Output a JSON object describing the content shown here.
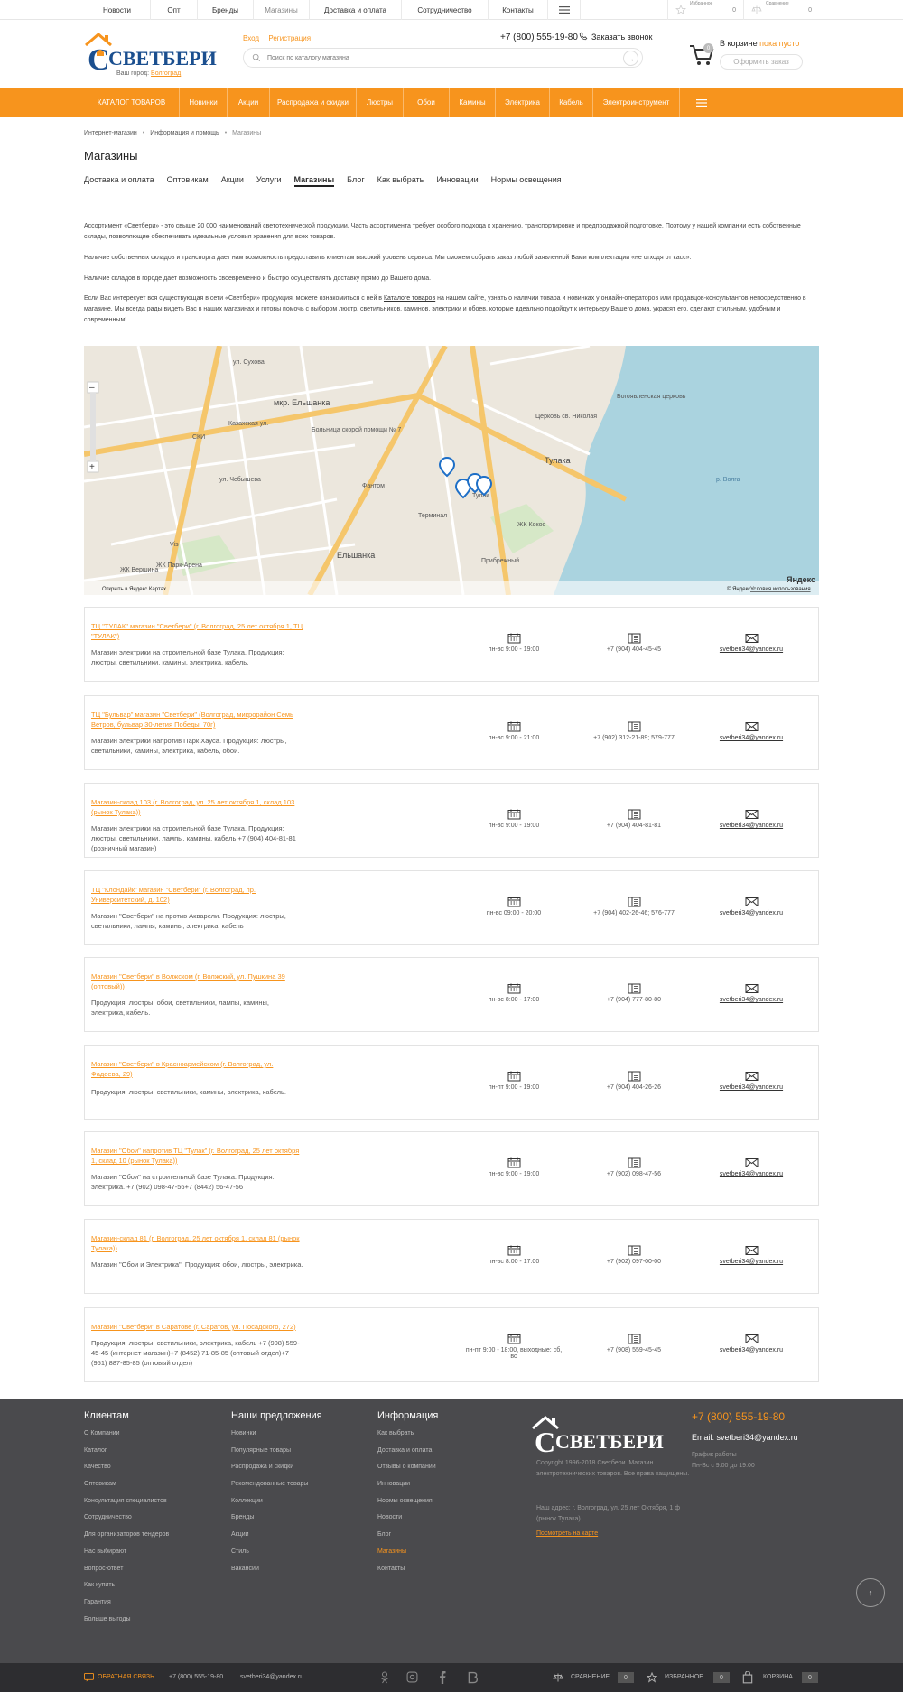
{
  "topnav": [
    "Новости",
    "Опт",
    "Бренды",
    "Магазины",
    "Доставка и оплата",
    "Сотрудничество",
    "Контакты"
  ],
  "top_icons": {
    "favorites_label": "Избранное",
    "favorites_count": "0",
    "compare_label": "Сравнение",
    "compare_count": "0"
  },
  "header": {
    "logo_text": "СВЕТБЕРИ",
    "city_label": "Ваш город:",
    "city": "Волгоград",
    "login": "Вход",
    "register": "Регистрация",
    "phone": "+7 (800) 555-19-80",
    "callback": "Заказать звонок",
    "search_placeholder": "Поиск по каталогу магазина",
    "cart_badge": "0",
    "cart_label": "В корзине",
    "cart_status": "пока пусто",
    "checkout": "Оформить заказ"
  },
  "mainnav": [
    "КАТАЛОГ ТОВАРОВ",
    "Новинки",
    "Акции",
    "Распродажа и скидки",
    "Люстры",
    "Обои",
    "Камины",
    "Электрика",
    "Кабель",
    "Электроинструмент"
  ],
  "breadcrumbs": [
    "Интернет-магазин",
    "Информация и помощь",
    "Магазины"
  ],
  "page_title": "Магазины",
  "subtabs": [
    "Доставка и оплата",
    "Оптовикам",
    "Акции",
    "Услуги",
    "Магазины",
    "Блог",
    "Как выбрать",
    "Инновации",
    "Нормы освещения"
  ],
  "active_subtab": "Магазины",
  "paragraphs": [
    "Ассортимент «Светбери» - это свыше 20 000 наименований светотехнической продукции. Часть ассортимента требует особого подхода к хранению, транспортировке и предпродажной подготовке. Поэтому у нашей компании есть собственные склады, позволяющие обеспечивать идеальные условия хранения для всех товаров.",
    "Наличие собственных складов и транспорта дает нам возможность предоставить клиентам высокий уровень сервиса. Мы сможем собрать заказ любой заявленной Вами комплектации «не отходя от касс».",
    "Наличие складов в городе дает возможность своевременно и быстро осуществлять доставку прямо до Вашего дома."
  ],
  "paragraph4": {
    "before": "Если Вас интересует вся существующая в сети «Светбери» продукция, можете ознакомиться с ней в ",
    "link": "Каталоге товаров",
    "after": " на нашем сайте, узнать о наличии товара и новинках у онлайн-операторов или продавцов-консультантов непосредственно в магазине. Мы всегда рады видеть Вас в наших магазинах и готовы помочь с выбором люстр, светильников, каминов, электрики и обоев, которые идеально подойдут к интерьеру Вашего дома, украсят его, сделают стильным, удобным и современным!"
  },
  "map": {
    "labels": [
      "ул. Сухова",
      "Казахская ул.",
      "мкр. Ельшанка",
      "Больница скорой помощи № 7",
      "ул. Чебышева",
      "СКИ",
      "ЖК Парк-Арена",
      "ЖК Вершина",
      "Ельшанка",
      "Прибрежный",
      "ЖК Кокос",
      "Терминал",
      "Тулак",
      "Тулака",
      "Богоявленская церковь",
      "Церковь св. Николая",
      "р. Волга",
      "Фантом",
      "Vis"
    ],
    "open_link": "Открыть в Яндекс.Картах",
    "copyright": "© Яндекс",
    "terms": "Условия использования",
    "brand": "Яндекс"
  },
  "stores": [
    {
      "name": "ТЦ \"ТУЛАК\" магазин \"Светбери\" (г. Волгоград, 25 лет октября 1, ТЦ \"ТУЛАК\")",
      "desc": "Магазин электрики на строительной базе Тулака. Продукция: люстры, светильники, камины, электрика, кабель.",
      "hours": "пн-вс 9:00 - 19:00",
      "phone": "+7 (904) 404-45-45",
      "email": "svetberi34@yandex.ru"
    },
    {
      "name": "ТЦ \"Бульвар\" магазин \"Светбери\" (Волгоград, микрорайон Семь Ветров, бульвар 30-летия Победы, 70г)",
      "desc": "Магазин электрики напротив Парк Хауса. Продукция: люстры, светильники, камины, электрика, кабель, обои.",
      "hours": "пн-вс 9:00 - 21:00",
      "phone": "+7 (902) 312-21-89; 579-777",
      "email": "svetberi34@yandex.ru"
    },
    {
      "name": "Магазин-склад 103 (г. Волгоград, ул. 25 лет октября 1, склад 103 (рынок Тулака))",
      "desc": "Магазин электрики на строительной базе Тулака. Продукция: люстры, светильники, лампы, камины, кабель +7 (904) 404-81-81 (розничный магазин)",
      "hours": "пн-вс 9:00 - 19:00",
      "phone": "+7 (904) 404-81-81",
      "email": "svetberi34@yandex.ru"
    },
    {
      "name": "ТЦ \"Клондайк\" магазин \"Светбери\" (г. Волгоград, пр. Университетский, д. 102)",
      "desc": "Магазин \"Светбери\" на против Акварели. Продукция: люстры, светильники, лампы, камины, электрика, кабель",
      "hours": "пн-вс 09:00 - 20:00",
      "phone": "+7 (904) 402-26-46; 576-777",
      "email": "svetberi34@yandex.ru"
    },
    {
      "name": "Магазин \"Светбери\" в Волжском (г. Волжский, ул. Пушкина 39 (оптовый))",
      "desc": "Продукция: люстры, обои, светильники, лампы, камины, электрика, кабель.",
      "hours": "пн-вс 8:00 - 17:00",
      "phone": "+7 (904) 777-80-80",
      "email": "svetberi34@yandex.ru"
    },
    {
      "name": "Магазин \"Светбери\" в Красноармейском (г. Волгоград, ул. Фадеева, 29)",
      "desc": "Продукция: люстры, светильники, камины, электрика, кабель.",
      "hours": "пн-пт 9:00 - 19:00",
      "phone": "+7 (904) 404-26-26",
      "email": "svetberi34@yandex.ru"
    },
    {
      "name": "Магазин \"Обои\" напротив ТЦ \"Тулак\" (г. Волгоград, 25 лет октября 1, склад 10 (рынок Тулака))",
      "desc": "Магазин \"Обои\" на строительной базе Тулака. Продукция: электрика. +7 (902) 098-47-56+7 (8442) 56-47-56",
      "hours": "пн-вс 9:00 - 19:00",
      "phone": "+7 (902) 098-47-56",
      "email": "svetberi34@yandex.ru"
    },
    {
      "name": "Магазин-склад 81 (г. Волгоград, 25 лет октября 1, склад 81 (рынок Тулака))",
      "desc": "Магазин \"Обои и Электрика\". Продукция: обои, люстры, электрика.",
      "hours": "пн-вс 8:00 - 17:00",
      "phone": "+7 (902) 097-00-00",
      "email": "svetberi34@yandex.ru"
    },
    {
      "name": "Магазин \"Светбери\" в Саратове (г. Саратов, ул. Посадского, 272)",
      "desc": "Продукция: люстры, светильники, электрика, кабель +7 (908) 559-45-45 (интернет магазин)+7 (8452) 71-85-85 (оптовый отдел)+7 (951) 887-85-85 (оптовый отдел)",
      "hours": "пн-пт 9:00 - 18:00, выходные: сб, вс",
      "phone": "+7 (908) 559-45-45",
      "email": "svetberi34@yandex.ru"
    }
  ],
  "footer": {
    "col1_title": "Клиентам",
    "col1": [
      "О Компании",
      "Каталог",
      "Качество",
      "Оптовикам",
      "Консультация специалистов",
      "Сотрудничество",
      "Для организаторов тендеров",
      "Нас выбирают",
      "Вопрос-ответ",
      "Как купить",
      "Гарантия",
      "Больше выгоды"
    ],
    "col2_title": "Наши предложения",
    "col2": [
      "Новинки",
      "Популярные товары",
      "Распродажа и скидки",
      "Рекомендованные товары",
      "Коллекции",
      "Бренды",
      "Акции",
      "Стиль",
      "Вакансии"
    ],
    "col3_title": "Информация",
    "col3": [
      "Как выбрать",
      "Доставка и оплата",
      "Отзывы о компании",
      "Инновации",
      "Нормы освещения",
      "Новости",
      "Блог",
      "Магазины",
      "Контакты"
    ],
    "col3_active": "Магазины",
    "logo_text": "СВЕТБЕРИ",
    "copyright": "Copyright 1996-2018 Светбери. Магазин электротехнических товаров. Все права защищены.",
    "address": "Наш адрес: г. Волгоград, ул. 25 лет Октября, 1 ф (рынок Тулака)",
    "map_link": "Посмотреть на карте",
    "phone": "+7 (800) 555-19-80",
    "email": "Email: svetberi34@yandex.ru",
    "schedule_title": "График работы",
    "schedule": "Пн-Вс с 9:00 до 19:00"
  },
  "bottombar": {
    "feedback": "ОБРАТНАЯ СВЯЗЬ",
    "phone": "+7 (800) 555-19-80",
    "email": "svetberi34@yandex.ru",
    "compare": "СРАВНЕНИЕ",
    "compare_count": "0",
    "favorites": "ИЗБРАННОЕ",
    "favorites_count": "0",
    "cart": "КОРЗИНА",
    "cart_count": "0"
  },
  "colors": {
    "accent": "#f7941d",
    "brand_blue": "#1b4f8f",
    "footer": "#4a4a4d",
    "bottombar": "#2d2d30"
  }
}
